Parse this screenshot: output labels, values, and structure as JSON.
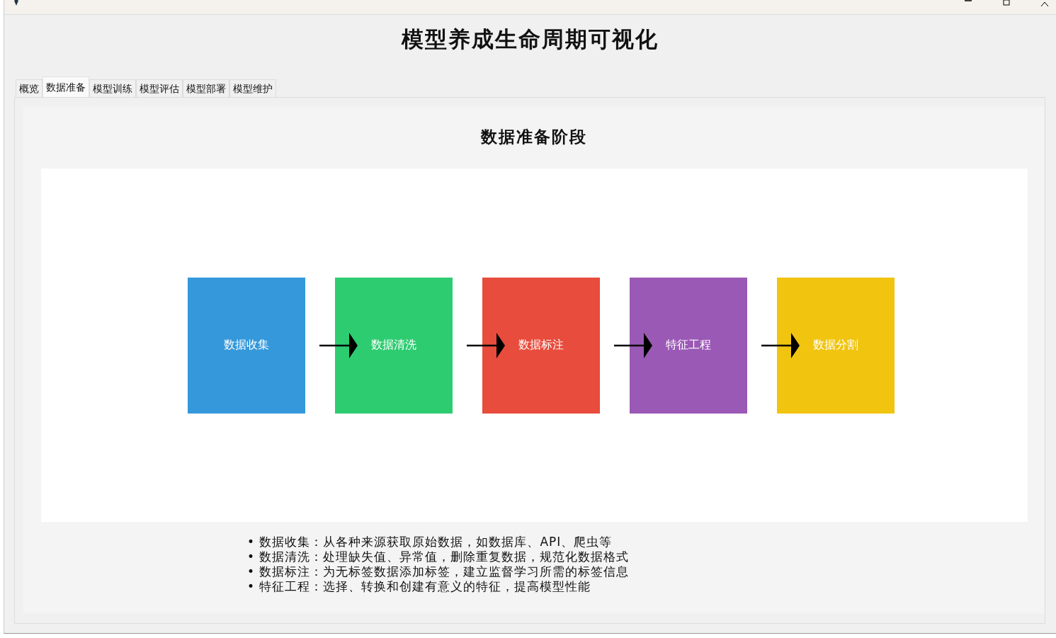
{
  "app": {
    "heading": "模型养成生命周期可视化"
  },
  "tabs": [
    {
      "label": "概览",
      "selected": false
    },
    {
      "label": "数据准备",
      "selected": true
    },
    {
      "label": "模型训练",
      "selected": false
    },
    {
      "label": "模型评估",
      "selected": false
    },
    {
      "label": "模型部署",
      "selected": false
    },
    {
      "label": "模型维护",
      "selected": false
    }
  ],
  "stage": {
    "title": "数据准备阶段",
    "steps": [
      {
        "label": "数据收集",
        "color": "#3498db"
      },
      {
        "label": "数据清洗",
        "color": "#2ecc71"
      },
      {
        "label": "数据标注",
        "color": "#e74c3c"
      },
      {
        "label": "特征工程",
        "color": "#9b59b6"
      },
      {
        "label": "数据分割",
        "color": "#f1c40f"
      }
    ],
    "details": [
      "• 数据收集：从各种来源获取原始数据，如数据库、API、爬虫等",
      "• 数据清洗：处理缺失值、异常值，删除重复数据，规范化数据格式",
      "• 数据标注：为无标签数据添加标签，建立监督学习所需的标签信息",
      "• 特征工程：选择、转换和创建有意义的特征，提高模型性能"
    ]
  }
}
